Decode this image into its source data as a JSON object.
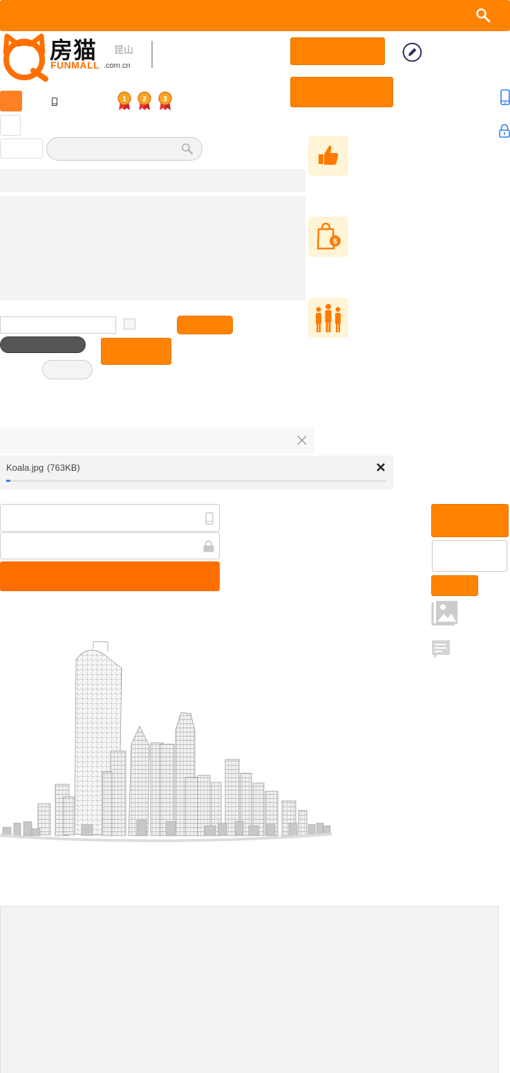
{
  "logo": {
    "text_cn": "房猫",
    "text_en": "FUNMALL",
    "domain": ".com.cn",
    "city": "昆山"
  },
  "upload": {
    "file_name": "Koala.jpg",
    "file_size": "(763KB)",
    "progress": 0.01
  },
  "colors": {
    "brand_orange": "#ff8201",
    "login_orange": "#ff6f00",
    "panel_gray": "#f3f3f3",
    "icon_blue": "#2f7fe8",
    "icon_bg_yellow": "#fff4d6"
  },
  "icons": {
    "search": "search-icon",
    "edit": "pencil-circle-icon",
    "phone": "mobile-phone-icon",
    "lock": "lock-icon",
    "medals": [
      "medal-1-icon",
      "medal-2-icon",
      "medal-3-icon"
    ],
    "features": [
      "thumbs-up-icon",
      "shopping-bag-dollar-icon",
      "people-group-icon"
    ],
    "image": "image-gallery-icon",
    "comment": "comment-icon",
    "close": "close-icon"
  }
}
